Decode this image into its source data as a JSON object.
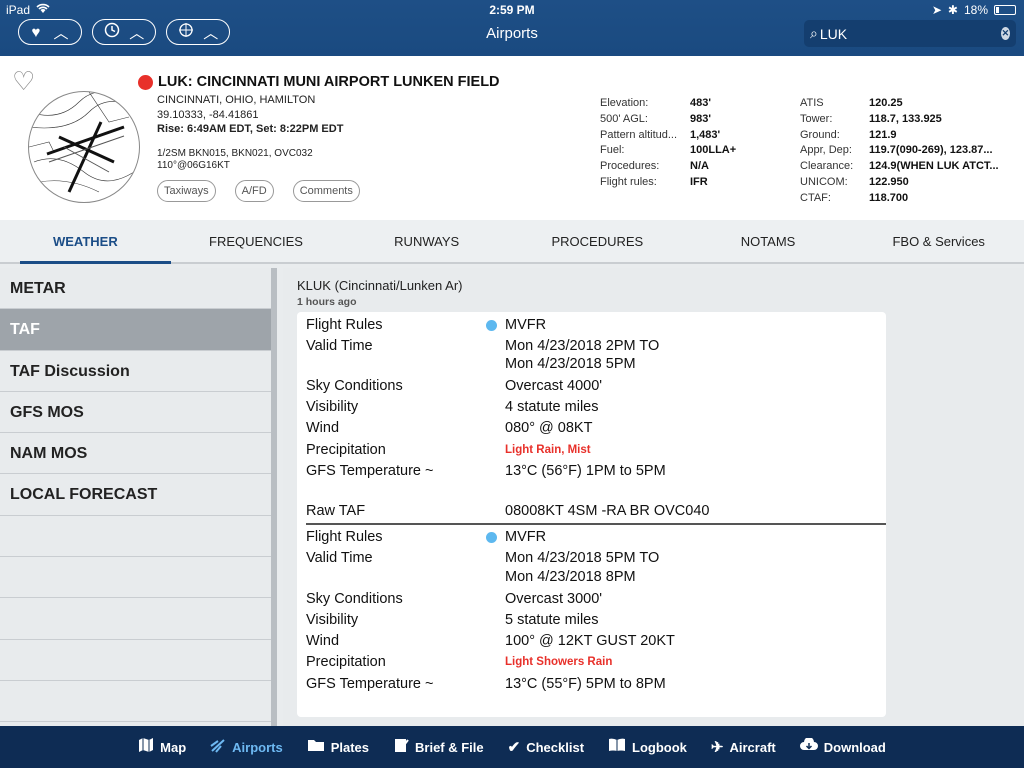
{
  "status": {
    "device": "iPad",
    "time": "2:59 PM",
    "battery": "18%"
  },
  "nav": {
    "title": "Airports",
    "search_value": "LUK"
  },
  "airport": {
    "name": "LUK: CINCINNATI MUNI AIRPORT LUNKEN FIELD",
    "city": "CINCINNATI, OHIO, HAMILTON",
    "coords": "39.10333, -84.41861",
    "sun": "Rise: 6:49AM EDT, Set: 8:22PM EDT",
    "wx_line1": "1/2SM BKN015, BKN021, OVC032",
    "wx_line2": "110°@06G16KT",
    "chips": [
      "Taxiways",
      "A/FD",
      "Comments"
    ],
    "info_left": [
      {
        "k": "Elevation:",
        "v": "483'"
      },
      {
        "k": "500' AGL:",
        "v": "983'"
      },
      {
        "k": "Pattern altitud...",
        "v": "1,483'"
      },
      {
        "k": "Fuel:",
        "v": "100LLA+"
      },
      {
        "k": "Procedures:",
        "v": "N/A"
      },
      {
        "k": "Flight rules:",
        "v": "IFR"
      }
    ],
    "info_right": [
      {
        "k": "ATIS",
        "v": "120.25"
      },
      {
        "k": "Tower:",
        "v": "118.7, 133.925"
      },
      {
        "k": "Ground:",
        "v": "121.9"
      },
      {
        "k": "Appr, Dep:",
        "v": "119.7(090-269), 123.87..."
      },
      {
        "k": "Clearance:",
        "v": "124.9(WHEN LUK ATCT..."
      },
      {
        "k": "UNICOM:",
        "v": "122.950"
      },
      {
        "k": "CTAF:",
        "v": "118.700"
      }
    ]
  },
  "tabs": [
    "WEATHER",
    "FREQUENCIES",
    "RUNWAYS",
    "PROCEDURES",
    "NOTAMS",
    "FBO & Services"
  ],
  "left_list": [
    "METAR",
    "TAF",
    "TAF Discussion",
    "GFS MOS",
    "NAM MOS",
    "LOCAL FORECAST"
  ],
  "taf": {
    "station": "KLUK (Cincinnati/Lunken Ar)",
    "age": "1 hours ago",
    "period1": {
      "flight_rules_label": "Flight Rules",
      "flight_rules": "MVFR",
      "valid_label": "Valid Time",
      "valid1": "Mon 4/23/2018 2PM TO",
      "valid2": "Mon 4/23/2018 5PM",
      "sky_label": "Sky Conditions",
      "sky": "Overcast 4000'",
      "vis_label": "Visibility",
      "vis": "4 statute miles",
      "wind_label": "Wind",
      "wind": "080° @ 08KT",
      "precip_label": "Precipitation",
      "precip": "Light Rain, Mist",
      "temp_label": "GFS Temperature ~",
      "temp": "13°C (56°F) 1PM to 5PM",
      "raw_label": "Raw TAF",
      "raw": "08008KT 4SM -RA BR OVC040"
    },
    "period2": {
      "flight_rules_label": "Flight Rules",
      "flight_rules": "MVFR",
      "valid_label": "Valid Time",
      "valid1": "Mon 4/23/2018 5PM TO",
      "valid2": "Mon 4/23/2018 8PM",
      "sky_label": "Sky Conditions",
      "sky": "Overcast 3000'",
      "vis_label": "Visibility",
      "vis": "5 statute miles",
      "wind_label": "Wind",
      "wind": "100° @ 12KT GUST 20KT",
      "precip_label": "Precipitation",
      "precip": "Light Showers Rain",
      "temp_label": "GFS Temperature ~",
      "temp": "13°C (55°F) 5PM to 8PM"
    }
  },
  "bottom": [
    "Map",
    "Airports",
    "Plates",
    "Brief & File",
    "Checklist",
    "Logbook",
    "Aircraft",
    "Download"
  ],
  "colors": {
    "nav_bg": "#1a4a80",
    "accent": "#1b4d87",
    "precip_red": "#e8302a",
    "mvfr_dot": "#5db8ef",
    "bottom_bg": "#0e2c54"
  }
}
